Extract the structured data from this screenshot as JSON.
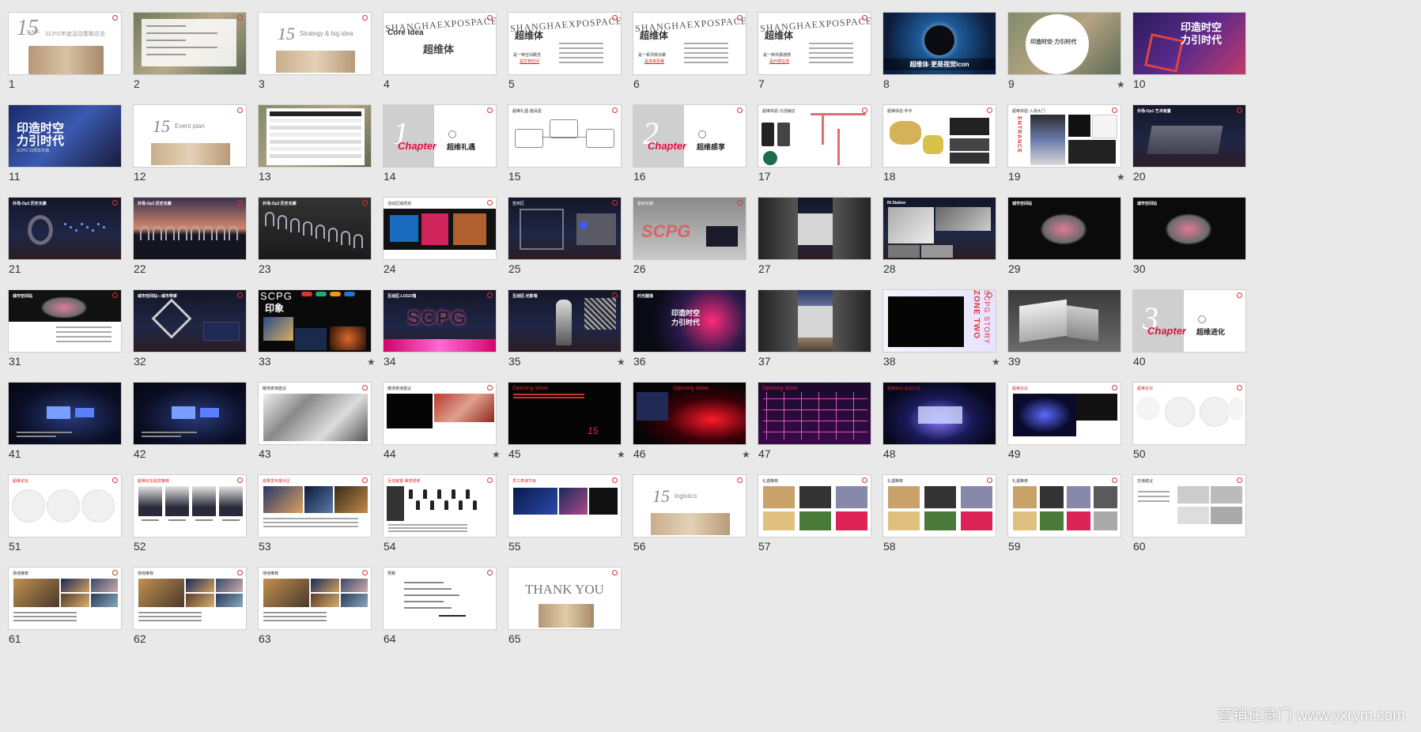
{
  "colors": {
    "background": "#e9e9e9",
    "accent": "#d8282c",
    "chapter": "#e0103c"
  },
  "slides": [
    {
      "n": "1",
      "star": "",
      "kind": "intro15",
      "theme": "light",
      "texts": [
        "15",
        "YEARS",
        "SCPG年度活动策略总览"
      ]
    },
    {
      "n": "2",
      "star": "",
      "kind": "aerialtext",
      "theme": "light",
      "texts": []
    },
    {
      "n": "3",
      "star": "",
      "kind": "section15",
      "theme": "light",
      "texts": [
        "15",
        "Strategy & big idea"
      ]
    },
    {
      "n": "4",
      "star": "",
      "kind": "shexpo",
      "theme": "light",
      "texts": [
        "SHANGHAEXPOSPACE",
        "Core Idea",
        "超维体"
      ]
    },
    {
      "n": "5",
      "star": "",
      "kind": "shexpo",
      "theme": "light",
      "texts": [
        "SHANGHAEXPOSPACE",
        "超维体",
        "是一种空间概念",
        "是生物空间"
      ]
    },
    {
      "n": "6",
      "star": "",
      "kind": "shexpo",
      "theme": "light",
      "texts": [
        "SHANGHAEXPOSPACE",
        "超维体",
        "是一系列观点聚",
        "是未来思维"
      ]
    },
    {
      "n": "7",
      "star": "",
      "kind": "shexpo",
      "theme": "light",
      "texts": [
        "SHANGHAEXPOSPACE",
        "超维体",
        "是一种共振通感",
        "是外部在场"
      ]
    },
    {
      "n": "8",
      "star": "",
      "kind": "icon",
      "theme": "dark",
      "texts": [
        "超维体·更是视觉Icon"
      ]
    },
    {
      "n": "9",
      "star": "★",
      "kind": "circlephoto",
      "theme": "photo",
      "texts": [
        "印造时空·力引时代"
      ]
    },
    {
      "n": "10",
      "star": "",
      "kind": "kv",
      "theme": "dark",
      "texts": [
        "印造时空",
        "力引时代"
      ]
    },
    {
      "n": "11",
      "star": "",
      "kind": "kv2",
      "theme": "dark",
      "texts": [
        "印造时空",
        "力引时代",
        "SCPG 15周年庆典"
      ]
    },
    {
      "n": "12",
      "star": "",
      "kind": "section15",
      "theme": "light",
      "texts": [
        "15",
        "Event plan"
      ]
    },
    {
      "n": "13",
      "star": "",
      "kind": "table",
      "theme": "photo",
      "texts": []
    },
    {
      "n": "14",
      "star": "",
      "kind": "chapter",
      "theme": "light",
      "texts": [
        "1",
        "Chapter",
        "超维礼遇"
      ]
    },
    {
      "n": "15",
      "star": "",
      "kind": "flow",
      "theme": "light",
      "texts": [
        "超维礼遇·邀请函"
      ]
    },
    {
      "n": "16",
      "star": "",
      "kind": "chapter",
      "theme": "light",
      "texts": [
        "2",
        "Chapter",
        "超维感享"
      ]
    },
    {
      "n": "17",
      "star": "",
      "kind": "phones",
      "theme": "light",
      "texts": [
        "超维体验·沉浸触达"
      ]
    },
    {
      "n": "18",
      "star": "",
      "kind": "gifts",
      "theme": "light",
      "texts": [
        "超维体验·伴手"
      ]
    },
    {
      "n": "19",
      "star": "★",
      "kind": "entrance",
      "theme": "light",
      "texts": [
        "超维体验·入场大门",
        "ENTRANCE"
      ]
    },
    {
      "n": "20",
      "star": "",
      "kind": "building",
      "theme": "dark",
      "texts": [
        "外场-Op1 艺术装置"
      ]
    },
    {
      "n": "21",
      "star": "",
      "kind": "ring",
      "theme": "dark",
      "texts": [
        "外场-Op2 历史长廊"
      ]
    },
    {
      "n": "22",
      "star": "",
      "kind": "arches",
      "theme": "dark",
      "texts": [
        "外场-Op2 历史长廊"
      ]
    },
    {
      "n": "23",
      "star": "",
      "kind": "arches2",
      "theme": "dark",
      "texts": [
        "外场-Op2 历史长廊"
      ]
    },
    {
      "n": "24",
      "star": "",
      "kind": "boards",
      "theme": "light",
      "texts": [
        "活动区域规划"
      ]
    },
    {
      "n": "25",
      "star": "",
      "kind": "cube",
      "theme": "dark",
      "texts": [
        "签到区"
      ]
    },
    {
      "n": "26",
      "star": "",
      "kind": "scpgwall",
      "theme": "light",
      "texts": [
        "签到长廊",
        "SCPG"
      ]
    },
    {
      "n": "27",
      "star": "",
      "kind": "tunnel",
      "theme": "dark",
      "texts": [
        "IN Station"
      ]
    },
    {
      "n": "28",
      "star": "",
      "kind": "instation",
      "theme": "dark",
      "texts": [
        "IN Station"
      ]
    },
    {
      "n": "29",
      "star": "",
      "kind": "model",
      "theme": "dark",
      "texts": [
        "城市空间站"
      ]
    },
    {
      "n": "30",
      "star": "",
      "kind": "model",
      "theme": "dark",
      "texts": [
        "城市空间站"
      ]
    },
    {
      "n": "31",
      "star": "",
      "kind": "model2",
      "theme": "light",
      "texts": [
        "城市空间站"
      ]
    },
    {
      "n": "32",
      "star": "",
      "kind": "tri",
      "theme": "dark",
      "texts": [
        "城市空间站—城市带家"
      ]
    },
    {
      "n": "33",
      "star": "★",
      "kind": "scpgcollage",
      "theme": "dark",
      "texts": [
        "SCPG",
        "印象"
      ]
    },
    {
      "n": "34",
      "star": "",
      "kind": "neon",
      "theme": "dark",
      "texts": [
        "互动区-LOGO墙",
        "SCPG"
      ]
    },
    {
      "n": "35",
      "star": "★",
      "kind": "figure",
      "theme": "dark",
      "texts": [
        "互动区-光影墙"
      ]
    },
    {
      "n": "36",
      "star": "",
      "kind": "rays",
      "theme": "dark",
      "texts": [
        "时光隧道",
        "印造时空",
        "力引时代"
      ]
    },
    {
      "n": "37",
      "star": "",
      "kind": "corridor",
      "theme": "dark",
      "texts": [
        "时光隧道"
      ]
    },
    {
      "n": "38",
      "star": "★",
      "kind": "zonetwo",
      "theme": "light",
      "texts": [
        "ZONE TWO",
        "SCPG STORY"
      ]
    },
    {
      "n": "39",
      "star": "",
      "kind": "greybuilding",
      "theme": "grey",
      "texts": []
    },
    {
      "n": "40",
      "star": "",
      "kind": "chapter",
      "theme": "light",
      "texts": [
        "3",
        "Chapter",
        "超维进化"
      ]
    },
    {
      "n": "41",
      "star": "",
      "kind": "stage",
      "theme": "dark",
      "texts": []
    },
    {
      "n": "42",
      "star": "",
      "kind": "stage",
      "theme": "dark",
      "texts": []
    },
    {
      "n": "43",
      "star": "",
      "kind": "sketch",
      "theme": "light",
      "texts": [
        "暖场表演建议"
      ]
    },
    {
      "n": "44",
      "star": "★",
      "kind": "blackvideo",
      "theme": "light",
      "texts": [
        "暖场表演建议"
      ]
    },
    {
      "n": "45",
      "star": "★",
      "kind": "opening",
      "theme": "dark",
      "texts": [
        "Opening show",
        "15"
      ]
    },
    {
      "n": "46",
      "star": "★",
      "kind": "redlaser",
      "theme": "dark",
      "texts": [
        "Opening show"
      ]
    },
    {
      "n": "47",
      "star": "",
      "kind": "gridlaser",
      "theme": "dark",
      "texts": [
        "Opening show"
      ]
    },
    {
      "n": "48",
      "star": "",
      "kind": "stagelaser",
      "theme": "dark",
      "texts": [
        "超维启动·启动仪式"
      ]
    },
    {
      "n": "49",
      "star": "",
      "kind": "stagewhite",
      "theme": "light",
      "texts": [
        "超维论坛"
      ]
    },
    {
      "n": "50",
      "star": "",
      "kind": "circles",
      "theme": "light",
      "texts": [
        "超维论坛"
      ]
    },
    {
      "n": "51",
      "star": "",
      "kind": "circles3",
      "theme": "light",
      "texts": [
        "超维论坛"
      ]
    },
    {
      "n": "52",
      "star": "",
      "kind": "people",
      "theme": "light",
      "texts": [
        "超维论坛嘉宾推荐"
      ]
    },
    {
      "n": "53",
      "star": "",
      "kind": "photos",
      "theme": "light",
      "texts": [
        "成果发布展示区"
      ]
    },
    {
      "n": "54",
      "star": "",
      "kind": "figures",
      "theme": "light",
      "texts": [
        "互动装置·荣誉颁奖"
      ]
    },
    {
      "n": "55",
      "star": "",
      "kind": "screens",
      "theme": "light",
      "texts": [
        "员工表演节目"
      ]
    },
    {
      "n": "56",
      "star": "",
      "kind": "section15",
      "theme": "light",
      "texts": [
        "15",
        "logistics"
      ]
    },
    {
      "n": "57",
      "star": "",
      "kind": "giftgrid",
      "theme": "light",
      "texts": [
        "礼遇推荐"
      ]
    },
    {
      "n": "58",
      "star": "",
      "kind": "giftgrid2",
      "theme": "light",
      "texts": [
        "礼遇推荐"
      ]
    },
    {
      "n": "59",
      "star": "",
      "kind": "giftgrid3",
      "theme": "light",
      "texts": [
        "礼遇推荐"
      ]
    },
    {
      "n": "60",
      "star": "",
      "kind": "cars",
      "theme": "light",
      "texts": [
        "交通建议"
      ]
    },
    {
      "n": "61",
      "star": "",
      "kind": "venue",
      "theme": "light",
      "texts": [
        "场地推荐"
      ]
    },
    {
      "n": "62",
      "star": "",
      "kind": "venue2",
      "theme": "light",
      "texts": [
        "场地推荐"
      ]
    },
    {
      "n": "63",
      "star": "",
      "kind": "venue3",
      "theme": "light",
      "texts": [
        "场地推荐"
      ]
    },
    {
      "n": "64",
      "star": "",
      "kind": "budget",
      "theme": "light",
      "texts": [
        "预算"
      ]
    },
    {
      "n": "65",
      "star": "",
      "kind": "thankyou",
      "theme": "light",
      "texts": [
        "THANK YOU"
      ]
    }
  ],
  "watermark": "营销任意门 www.yxrym.com"
}
